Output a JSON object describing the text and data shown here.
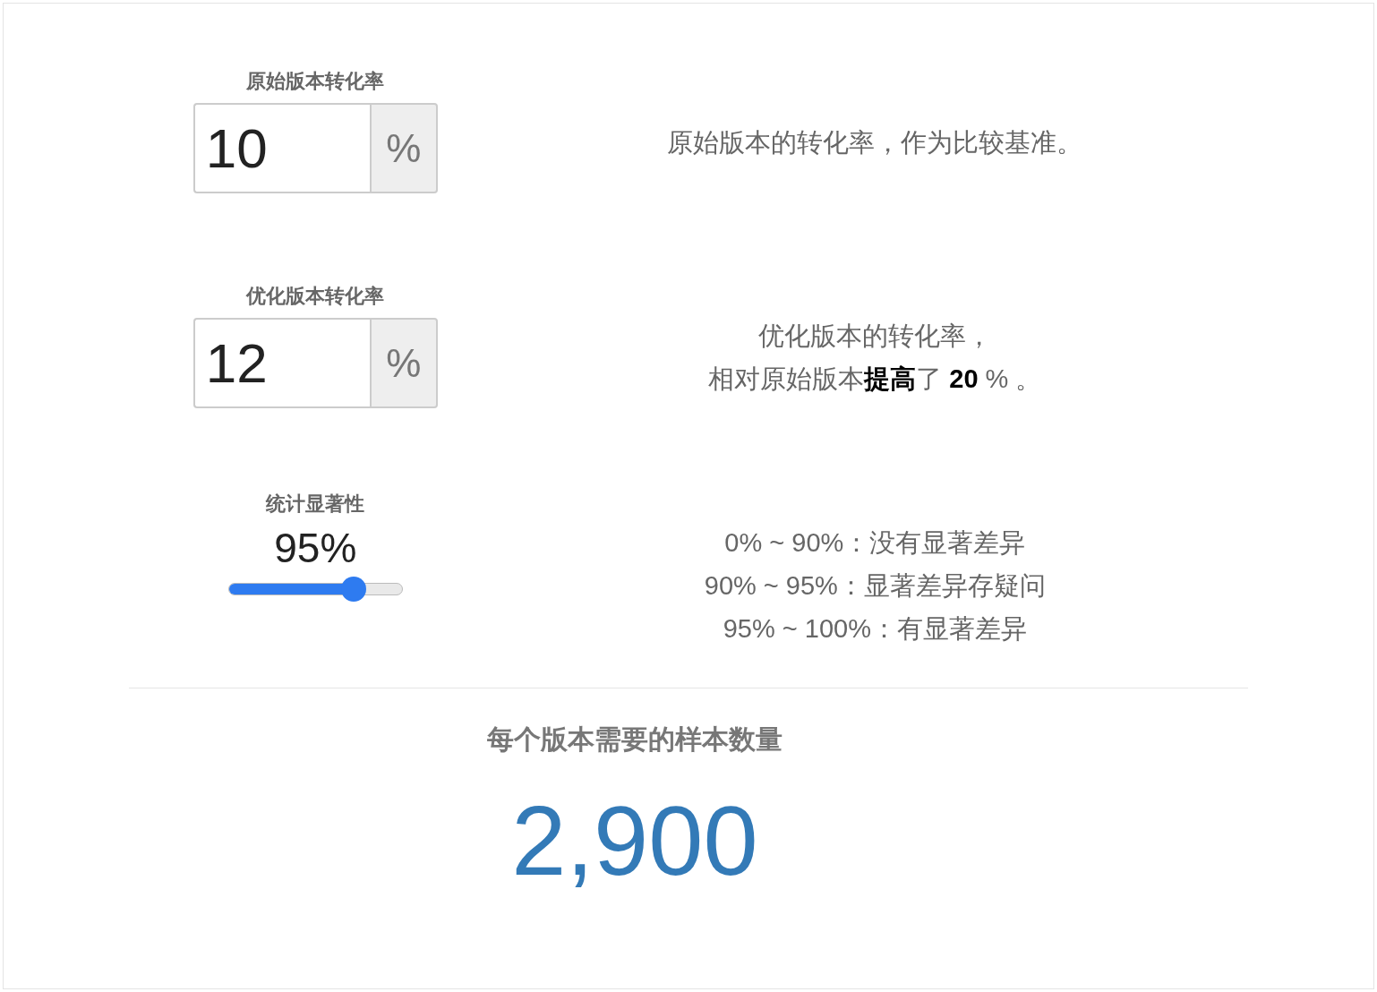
{
  "fields": [
    {
      "label": "原始版本转化率",
      "value": "10",
      "unit": "%",
      "description": [
        "原始版本的转化率，作为比较基准。"
      ]
    },
    {
      "label": "优化版本转化率",
      "value": "12",
      "unit": "%",
      "description": [
        "优化版本的转化率，",
        "相对原始版本**提高**了 **20** % 。"
      ]
    }
  ],
  "significance": {
    "label": "统计显著性",
    "reading": "95%",
    "level": 0.72,
    "description": [
      "0% ~ 90%：没有显著差异",
      "90% ~ 95%：显著差异存疑问",
      "95% ~ 100%：有显著差异"
    ]
  },
  "result": {
    "label": "每个版本需要的样本数量",
    "value": "2,900"
  }
}
